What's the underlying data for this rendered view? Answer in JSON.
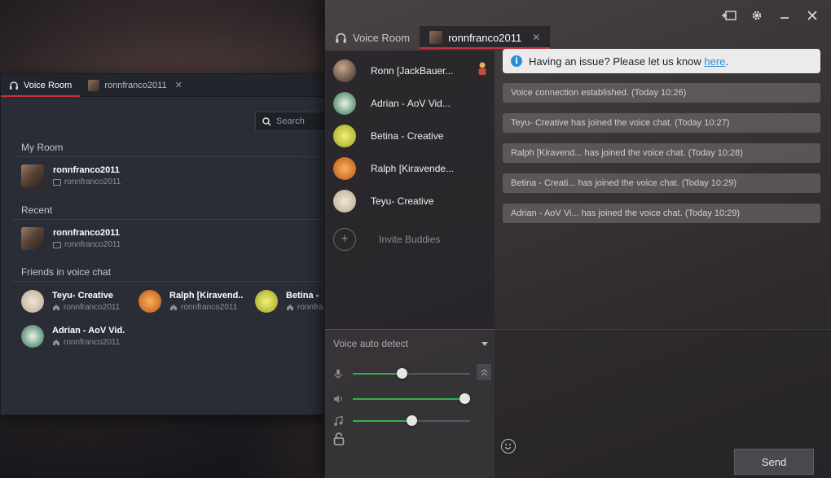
{
  "back_window": {
    "tabs": [
      {
        "label": "Voice Room",
        "active": true
      },
      {
        "label": "ronnfranco2011",
        "active": false
      }
    ],
    "search_placeholder": "Search",
    "my_room": {
      "title": "My Room",
      "name": "ronnfranco2011",
      "sub": "ronnfranco2011"
    },
    "recent": {
      "title": "Recent",
      "name": "ronnfranco2011",
      "sub": "ronnfranco2011"
    },
    "friends": {
      "title": "Friends in voice chat",
      "items": [
        {
          "name": "Teyu- Creative",
          "sub": "ronnfranco2011",
          "color": "#d8c9b4"
        },
        {
          "name": "Ralph [Kiravend..",
          "sub": "ronnfranco2011",
          "color": "#e2772e"
        },
        {
          "name": "Betina - ",
          "sub": "ronnfra",
          "color": "#c8d431"
        },
        {
          "name": "Adrian - AoV Vid.",
          "sub": "ronnfranco2011",
          "color": "#3a7d5a"
        }
      ]
    }
  },
  "front_window": {
    "tabs": [
      {
        "label": "Voice Room",
        "active": false
      },
      {
        "label": "ronnfranco2011",
        "active": true
      }
    ],
    "buddies": [
      {
        "name": "Ronn [JackBauer...",
        "color": "#6a5347",
        "owner": true
      },
      {
        "name": "Adrian - AoV Vid...",
        "color": "#3a7d5a",
        "owner": false
      },
      {
        "name": "Betina - Creative",
        "color": "#c8d431",
        "owner": false
      },
      {
        "name": "Ralph [Kiravende...",
        "color": "#e2772e",
        "owner": false
      },
      {
        "name": "Teyu- Creative",
        "color": "#d8c9b4",
        "owner": false
      }
    ],
    "invite_label": "Invite Buddies",
    "voice_mode": "Voice auto detect",
    "sliders": [
      {
        "icon": "microphone-icon",
        "level": 0.42
      },
      {
        "icon": "speaker-icon",
        "level": 0.95
      },
      {
        "icon": "music-icon",
        "level": 0.5
      }
    ],
    "notice": {
      "text": "Having an issue? Please let us know ",
      "link": "here",
      "suffix": "."
    },
    "messages": [
      "Voice connection established. (Today 10:26)",
      "Teyu- Creative has joined the voice chat. (Today 10:27)",
      "Ralph [Kiravend... has joined the voice chat. (Today 10:28)",
      "Betina - Creati... has joined the voice chat. (Today 10:29)",
      "Adrian - AoV Vi... has joined the voice chat. (Today 10:29)"
    ],
    "send_label": "Send"
  },
  "colors": {
    "accent_red": "#c8323a",
    "slider_green": "#2fb14a",
    "link_blue": "#2a8fd6"
  }
}
